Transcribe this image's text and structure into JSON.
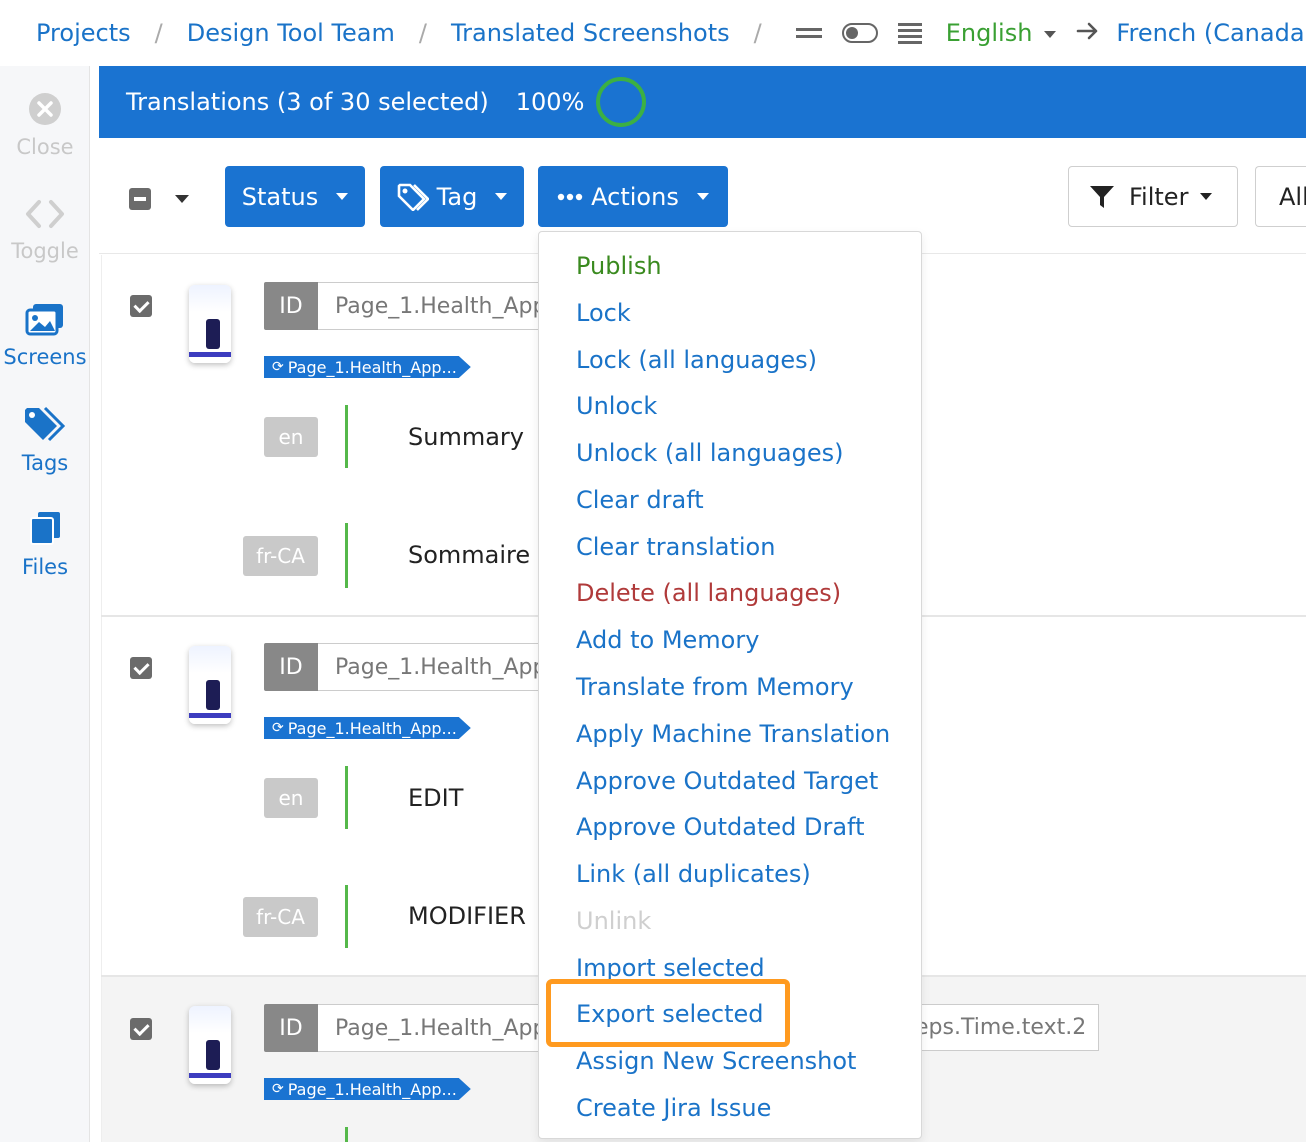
{
  "breadcrumb": {
    "projects": "Projects",
    "team": "Design Tool Team",
    "page": "Translated Screenshots",
    "separator": "/"
  },
  "language": {
    "source": "English",
    "target": "French (Canada)"
  },
  "sidebar": {
    "items": [
      {
        "label": "Close",
        "icon": "close-circle-icon",
        "state": "disabled"
      },
      {
        "label": "Toggle",
        "icon": "code-brackets-icon",
        "state": "disabled"
      },
      {
        "label": "Screens",
        "icon": "images-icon",
        "state": "active"
      },
      {
        "label": "Tags",
        "icon": "tags-icon",
        "state": "active"
      },
      {
        "label": "Files",
        "icon": "files-icon",
        "state": "active"
      }
    ]
  },
  "header": {
    "title": "Translations (3 of 30 selected)",
    "percent": "100%",
    "progress": 1.0
  },
  "toolbar": {
    "status_label": "Status",
    "tag_label": "Tag",
    "actions_label": "Actions",
    "filter_label": "Filter",
    "all_label": "All"
  },
  "rows": [
    {
      "id_label": "ID",
      "id_value": "Page_1.Health_App",
      "tag": "Page_1.Health_App...",
      "source_lang": "en",
      "source_text": "Summary",
      "target_lang": "fr-CA",
      "target_text": "Sommaire"
    },
    {
      "id_label": "ID",
      "id_value": "Page_1.Health_App",
      "tag": "Page_1.Health_App...",
      "source_lang": "en",
      "source_text": "EDIT",
      "target_lang": "fr-CA",
      "target_text": "MODIFIER"
    },
    {
      "id_label": "ID",
      "id_value": "Page_1.Health_App",
      "id_suffix": "eps.Time.text.2",
      "tag": "Page_1.Health_App..."
    }
  ],
  "actions_menu": [
    {
      "label": "Publish",
      "style": "green"
    },
    {
      "label": "Lock",
      "style": "normal"
    },
    {
      "label": "Lock (all languages)",
      "style": "normal"
    },
    {
      "label": "Unlock",
      "style": "normal"
    },
    {
      "label": "Unlock (all languages)",
      "style": "normal"
    },
    {
      "label": "Clear draft",
      "style": "normal"
    },
    {
      "label": "Clear translation",
      "style": "normal"
    },
    {
      "label": "Delete (all languages)",
      "style": "red"
    },
    {
      "label": "Add to Memory",
      "style": "normal"
    },
    {
      "label": "Translate from Memory",
      "style": "normal"
    },
    {
      "label": "Apply Machine Translation",
      "style": "normal"
    },
    {
      "label": "Approve Outdated Target",
      "style": "normal"
    },
    {
      "label": "Approve Outdated Draft",
      "style": "normal"
    },
    {
      "label": "Link (all duplicates)",
      "style": "normal"
    },
    {
      "label": "Unlink",
      "style": "disabled"
    },
    {
      "label": "Import selected",
      "style": "normal"
    },
    {
      "label": "Export selected",
      "style": "highlighted"
    },
    {
      "label": "Assign New Screenshot",
      "style": "normal"
    },
    {
      "label": "Create Jira Issue",
      "style": "normal"
    }
  ],
  "colors": {
    "primary": "#1a73d1",
    "link": "#1a73c8",
    "success": "#3aa033",
    "danger": "#b03a3a",
    "highlight": "#ff9a1f"
  }
}
